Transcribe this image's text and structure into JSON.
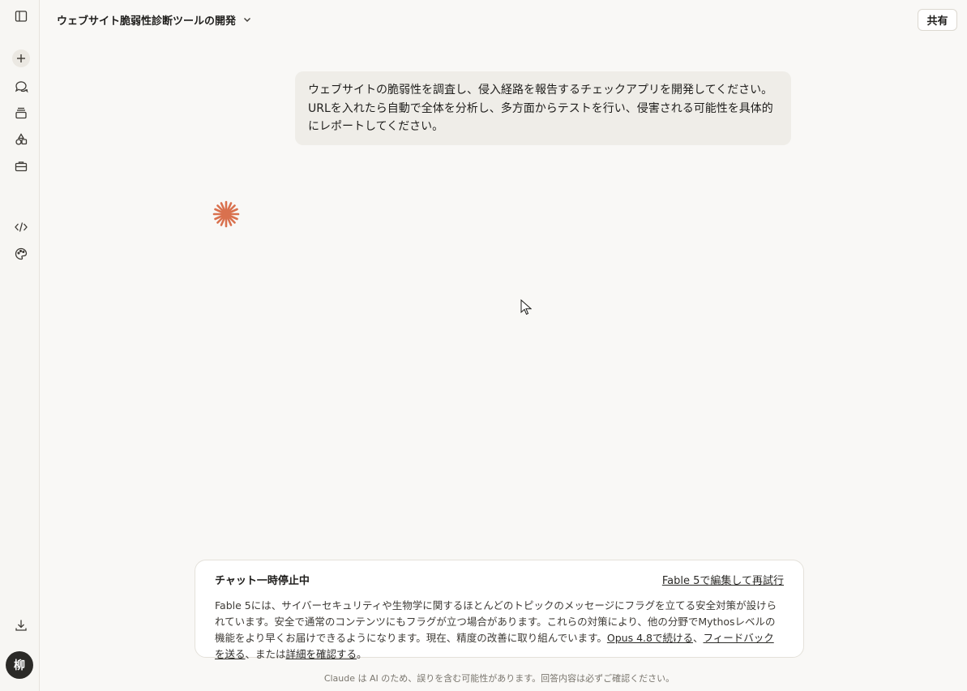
{
  "header": {
    "title": "ウェブサイト脆弱性診断ツールの開発",
    "share_label": "共有"
  },
  "user_message": {
    "text": "ウェブサイトの脆弱性を調査し、侵入経路を報告するチェックアプリを開発してください。URLを入れたら自動で全体を分析し、多方面からテストを行い、侵害される可能性を具体的にレポートしてください。"
  },
  "notice": {
    "title": "チャット一時停止中",
    "retry_link": "Fable 5で編集して再試行",
    "body_text": "Fable 5には、サイバーセキュリティや生物学に関するほとんどのトピックのメッセージにフラグを立てる安全対策が設けられています。安全で通常のコンテンツにもフラグが立つ場合があります。これらの対策により、他の分野でMythosレベルの機能をより早くお届けできるようになります。現在、精度の改善に取り組んでいます。",
    "link_continue": "Opus 4.8で続ける",
    "sep1": "、",
    "link_feedback": "フィードバックを送る",
    "sep2": "、または",
    "link_details": "詳細を確認する",
    "end": "。"
  },
  "disclaimer": "Claude は AI のため、誤りを含む可能性があります。回答内容は必ずご確認ください。",
  "user": {
    "avatar_initial": "柳"
  },
  "colors": {
    "accent": "#d9714e",
    "background": "#f9f8f6"
  },
  "icons": [
    "sidebar-toggle-icon",
    "new-chat-icon",
    "chats-icon",
    "projects-icon",
    "artifacts-icon",
    "toolbox-icon",
    "code-icon",
    "palette-icon",
    "download-icon",
    "chevron-down-icon",
    "spark-icon"
  ]
}
